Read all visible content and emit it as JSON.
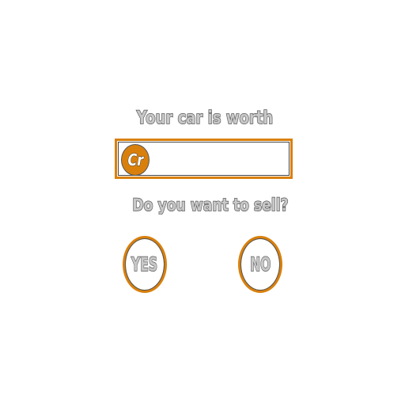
{
  "prompt": {
    "title": "Your car is worth",
    "question": "Do you want to sell?"
  },
  "value_display": {
    "currency_icon_text": "Cr",
    "icon": "credit-coin-icon",
    "value": ""
  },
  "buttons": {
    "yes_label": "YES",
    "no_label": "NO"
  },
  "colors": {
    "accent": "#d9800c",
    "text_fill": "#c8c8c8",
    "text_outline": "#555555",
    "background": "#ffffff"
  }
}
